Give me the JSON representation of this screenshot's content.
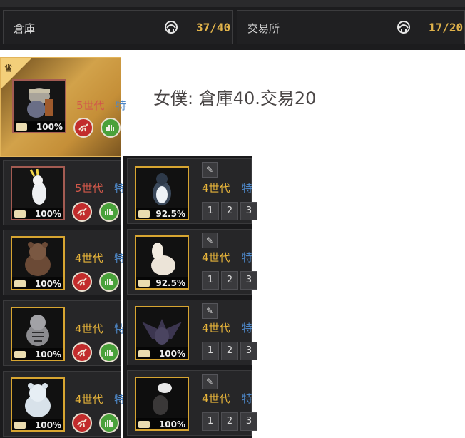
{
  "storage": {
    "label": "倉庫",
    "count": "37/40"
  },
  "exchange": {
    "label": "交易所",
    "count": "17/20"
  },
  "note": "女僕: 倉庫40.交易20",
  "left_pets": [
    {
      "gen": "5世代",
      "trait": "特",
      "pct": "100%",
      "animal": "armored-dog",
      "frame": "red"
    },
    {
      "gen": "5世代",
      "trait": "特",
      "pct": "100%",
      "animal": "cockatoo",
      "frame": "red"
    },
    {
      "gen": "4世代",
      "trait": "特",
      "pct": "100%",
      "animal": "brown-bear",
      "frame": "yellow"
    },
    {
      "gen": "4世代",
      "trait": "特",
      "pct": "100%",
      "animal": "white-tiger",
      "frame": "yellow"
    },
    {
      "gen": "4世代",
      "trait": "特",
      "pct": "100%",
      "animal": "polar-bear",
      "frame": "yellow"
    }
  ],
  "right_pets": [
    {
      "gen": "4世代",
      "trait": "特",
      "pct": "92.5%",
      "animal": "penguin",
      "frame": "yellow"
    },
    {
      "gen": "4世代",
      "trait": "特",
      "pct": "92.5%",
      "animal": "alpaca",
      "frame": "yellow"
    },
    {
      "gen": "4世代",
      "trait": "特",
      "pct": "100%",
      "animal": "dark-dragon",
      "frame": "yellow"
    },
    {
      "gen": "4世代",
      "trait": "特",
      "pct": "100%",
      "animal": "hawk",
      "frame": "yellow"
    }
  ],
  "skill_slots": [
    "1",
    "2",
    "3"
  ],
  "icons": {
    "maid": "maid-icon",
    "food": "food-bowl-icon",
    "run": "running-icon",
    "hand": "hand-icon",
    "edit": "pencil-icon",
    "crown": "crown-icon"
  },
  "colors": {
    "gold": "#e0b24a",
    "gen5": "#d2584a",
    "gen4": "#e7b43a",
    "trait": "#4d86c6"
  }
}
